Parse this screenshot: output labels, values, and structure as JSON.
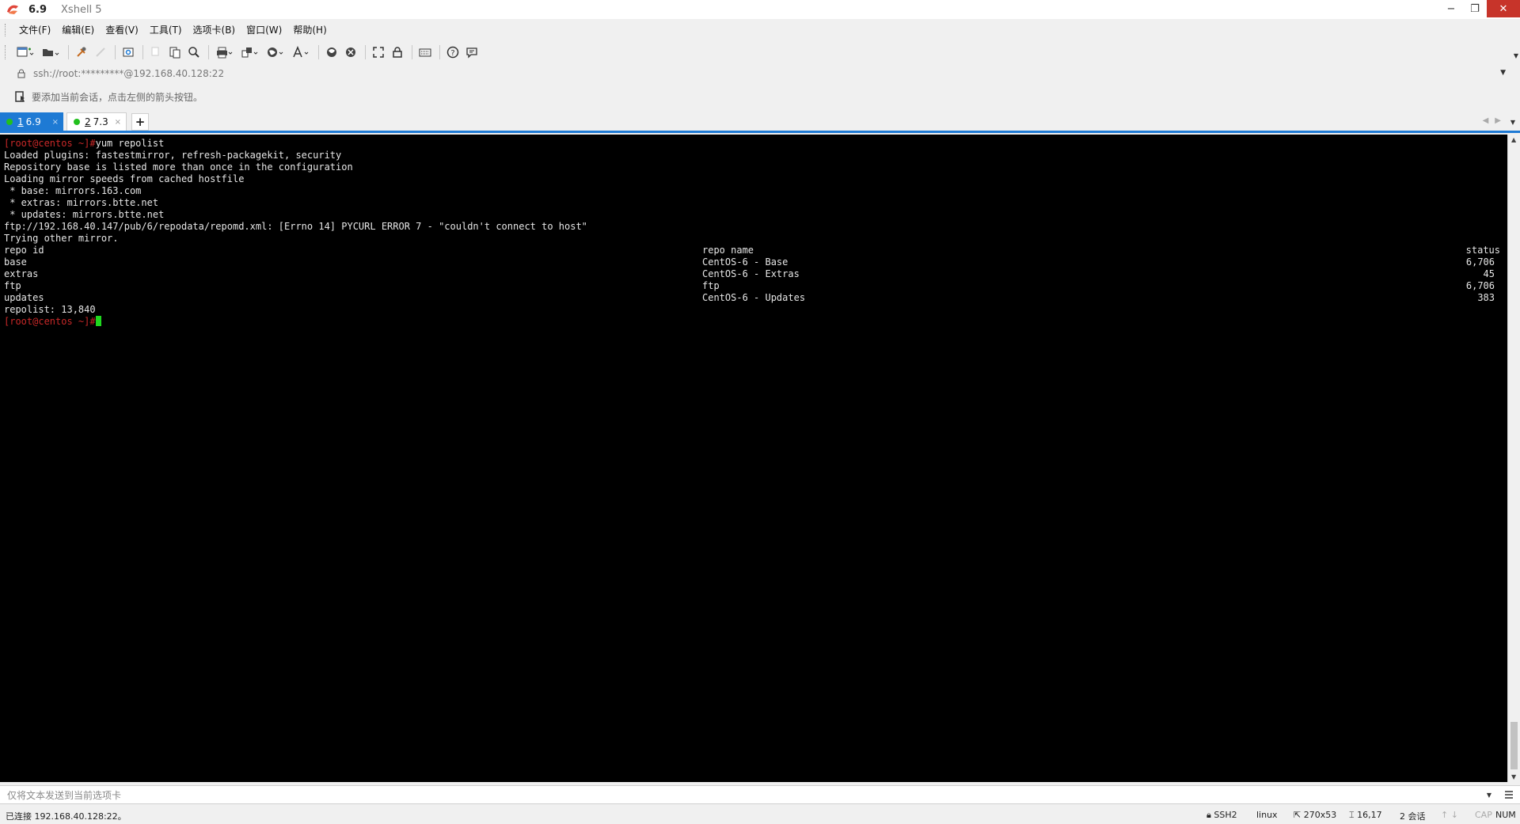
{
  "window": {
    "session_title": "6.9",
    "app_title": "Xshell 5",
    "minimize_label": "−",
    "restore_label": "❐",
    "close_label": "✕",
    "colors": {
      "accent": "#1e7ad4",
      "close_bg": "#c7342a",
      "connected_dot": "#22c01e",
      "prompt": "#c82828",
      "cursor": "#1fd81f"
    }
  },
  "menu": {
    "items": [
      "文件(F)",
      "编辑(E)",
      "查看(V)",
      "工具(T)",
      "选项卡(B)",
      "窗口(W)",
      "帮助(H)"
    ]
  },
  "toolbar": {
    "icons": [
      "new-session-icon",
      "open-folder-icon",
      "reconnect-icon",
      "disconnect-icon",
      "properties-icon",
      "copy-icon",
      "paste-icon",
      "find-icon",
      "print-icon",
      "transfer-icon",
      "globe-icon",
      "font-icon",
      "xftp-icon",
      "xmanager-icon",
      "fullscreen-icon",
      "lock-icon",
      "keyboard-icon",
      "help-icon",
      "chat-icon"
    ]
  },
  "address": {
    "value": "ssh://root:*********@192.168.40.128:22"
  },
  "info": {
    "text": "要添加当前会话，点击左侧的箭头按钮。"
  },
  "tabs": [
    {
      "num": "1",
      "label": "6.9",
      "active": true,
      "close": "×"
    },
    {
      "num": "2",
      "label": "7.3",
      "active": false,
      "close": "×"
    }
  ],
  "tab_add": "+",
  "terminal": {
    "prompt": "[root@centos ~]#",
    "command": "yum repolist",
    "lines": [
      "Loaded plugins: fastestmirror, refresh-packagekit, security",
      "Repository base is listed more than once in the configuration",
      "Loading mirror speeds from cached hostfile",
      " * base: mirrors.163.com",
      " * extras: mirrors.btte.net",
      " * updates: mirrors.btte.net",
      "ftp://192.168.40.147/pub/6/repodata/repomd.xml: [Errno 14] PYCURL ERROR 7 - \"couldn't connect to host\"",
      "Trying other mirror."
    ],
    "table": {
      "headers": {
        "id": "repo id",
        "name": "repo name",
        "status": "status"
      },
      "rows": [
        {
          "id": "base",
          "name": "CentOS-6 - Base",
          "status": "6,706"
        },
        {
          "id": "extras",
          "name": "CentOS-6 - Extras",
          "status": "45"
        },
        {
          "id": "ftp",
          "name": "ftp",
          "status": "6,706"
        },
        {
          "id": "updates",
          "name": "CentOS-6 - Updates",
          "status": "383"
        }
      ]
    },
    "summary": "repolist: 13,840"
  },
  "compose": {
    "placeholder": "仅将文本发送到当前选项卡"
  },
  "status": {
    "connection": "已连接 192.168.40.128:22。",
    "protocol": "SSH2",
    "terminal_type": "linux",
    "size": "270x53",
    "cursor_pos": "16,17",
    "sessions": "2 会话",
    "caps": "CAP",
    "num": "NUM"
  }
}
